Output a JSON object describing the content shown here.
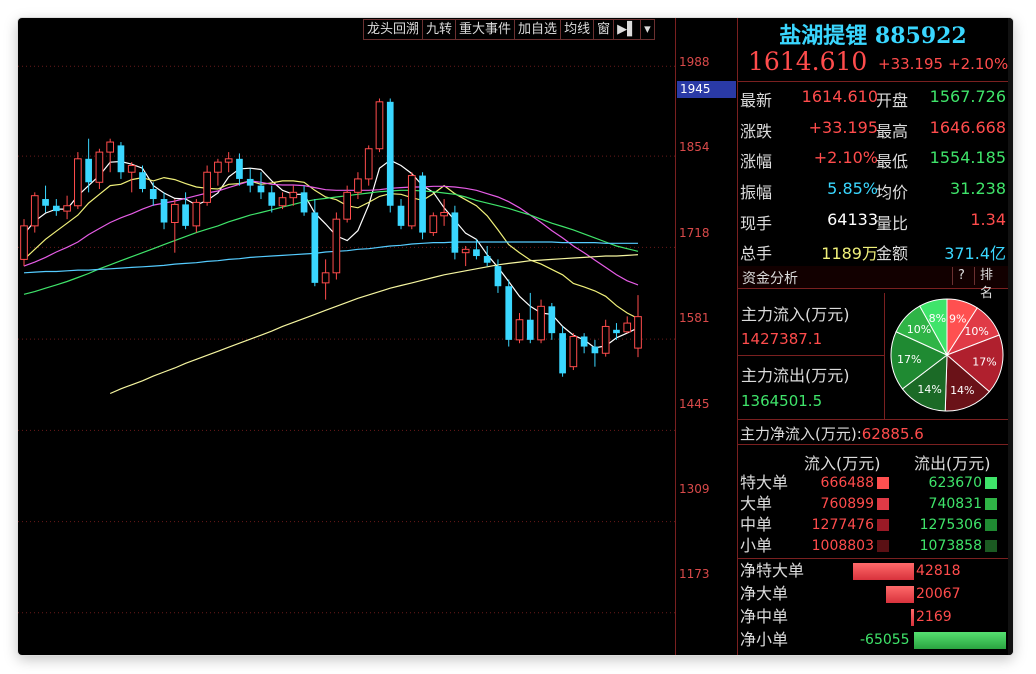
{
  "toolbar": {
    "items": [
      "龙头回溯",
      "九转",
      "重大事件",
      "加自选",
      "均线",
      "窗"
    ],
    "play_icon": "▶▌",
    "menu_icon": "▾"
  },
  "axis": {
    "ticks": [
      "1988",
      "1854",
      "1718",
      "1581",
      "1445",
      "1309",
      "1173"
    ],
    "current_marker": "1945"
  },
  "colors": {
    "up": "#ff4c4c",
    "down": "#3ad7ff",
    "ma5": "#ffffff",
    "ma10": "#f0f07a",
    "ma20": "#e65ce6",
    "ma30": "#3fe46a",
    "ma60": "#55ccff",
    "ma120": "#f5f5a0"
  },
  "quote": {
    "title": "盐湖提锂 885922",
    "price": "1614.610",
    "change": "+33.195",
    "change_pct": "+2.10%",
    "rows": [
      {
        "l1": "最新",
        "v1": "1614.610",
        "c1": "red",
        "l2": "开盘",
        "v2": "1567.726",
        "c2": "grn"
      },
      {
        "l1": "涨跌",
        "v1": "+33.195",
        "c1": "red",
        "l2": "最高",
        "v2": "1646.668",
        "c2": "red"
      },
      {
        "l1": "涨幅",
        "v1": "+2.10%",
        "c1": "red",
        "l2": "最低",
        "v2": "1554.185",
        "c2": "grn"
      },
      {
        "l1": "振幅",
        "v1": "5.85%",
        "c1": "cyan",
        "l2": "均价",
        "v2": "31.238",
        "c2": "grn"
      },
      {
        "l1": "现手",
        "v1": "64133",
        "c1": "wht",
        "l2": "量比",
        "v2": "1.34",
        "c2": "red"
      },
      {
        "l1": "总手",
        "v1": "1189万",
        "c1": "yel",
        "l2": "金额",
        "v2": "371.4亿",
        "c2": "cyan"
      }
    ]
  },
  "capital": {
    "title": "资金分析",
    "help": "?",
    "rank": "排名",
    "inflow_label": "主力流入(万元)",
    "inflow_value": "1427387.1",
    "outflow_label": "主力流出(万元)",
    "outflow_value": "1364501.5",
    "net_label": "主力净流入(万元):",
    "net_value": "62885.6",
    "pie": [
      {
        "label": "9%",
        "value": 9,
        "color": "#ff5050"
      },
      {
        "label": "10%",
        "value": 10,
        "color": "#e03a46"
      },
      {
        "label": "17%",
        "value": 17,
        "color": "#b0202e"
      },
      {
        "label": "14%",
        "value": 14,
        "color": "#6a1218"
      },
      {
        "label": "14%",
        "value": 14,
        "color": "#1b6a26"
      },
      {
        "label": "17%",
        "value": 17,
        "color": "#1f8a32"
      },
      {
        "label": "10%",
        "value": 10,
        "color": "#2fb446"
      },
      {
        "label": "8%",
        "value": 8,
        "color": "#3fe46a"
      }
    ],
    "table_head_in": "流入(万元)",
    "table_head_out": "流出(万元)",
    "table": [
      {
        "name": "特大单",
        "in": "666488",
        "out": "623670",
        "cin": "#ff5050",
        "cout": "#3fe46a"
      },
      {
        "name": "大单",
        "in": "760899",
        "out": "740831",
        "cin": "#e03a46",
        "cout": "#2fb446"
      },
      {
        "name": "中单",
        "in": "1277476",
        "out": "1275306",
        "cin": "#9a1a26",
        "cout": "#1f8a32"
      },
      {
        "name": "小单",
        "in": "1008803",
        "out": "1073858",
        "cin": "#5a1014",
        "cout": "#1b5a22"
      }
    ],
    "net": [
      {
        "name": "净特大单",
        "value": "42818",
        "amount": 42818
      },
      {
        "name": "净大单",
        "value": "20067",
        "amount": 20067
      },
      {
        "name": "净中单",
        "value": "2169",
        "amount": 2169
      },
      {
        "name": "净小单",
        "value": "-65055",
        "amount": -65055
      }
    ]
  },
  "chart_data": {
    "type": "candlestick",
    "ylim": [
      1110,
      2060
    ],
    "candles": [
      [
        1700,
        1760,
        1690,
        1750
      ],
      [
        1750,
        1800,
        1740,
        1795
      ],
      [
        1790,
        1810,
        1770,
        1780
      ],
      [
        1780,
        1790,
        1765,
        1772
      ],
      [
        1772,
        1795,
        1760,
        1780
      ],
      [
        1780,
        1860,
        1775,
        1850
      ],
      [
        1850,
        1880,
        1800,
        1815
      ],
      [
        1815,
        1865,
        1805,
        1860
      ],
      [
        1860,
        1880,
        1830,
        1875
      ],
      [
        1870,
        1875,
        1820,
        1830
      ],
      [
        1830,
        1845,
        1800,
        1840
      ],
      [
        1830,
        1840,
        1800,
        1805
      ],
      [
        1805,
        1815,
        1780,
        1790
      ],
      [
        1790,
        1800,
        1745,
        1755
      ],
      [
        1755,
        1790,
        1710,
        1782
      ],
      [
        1782,
        1800,
        1745,
        1750
      ],
      [
        1750,
        1790,
        1740,
        1785
      ],
      [
        1785,
        1840,
        1780,
        1830
      ],
      [
        1830,
        1850,
        1810,
        1845
      ],
      [
        1845,
        1860,
        1830,
        1850
      ],
      [
        1850,
        1858,
        1810,
        1820
      ],
      [
        1820,
        1835,
        1800,
        1810
      ],
      [
        1810,
        1830,
        1790,
        1800
      ],
      [
        1800,
        1810,
        1770,
        1780
      ],
      [
        1780,
        1800,
        1775,
        1792
      ],
      [
        1792,
        1810,
        1780,
        1800
      ],
      [
        1800,
        1810,
        1765,
        1770
      ],
      [
        1770,
        1790,
        1660,
        1665
      ],
      [
        1665,
        1700,
        1640,
        1680
      ],
      [
        1680,
        1770,
        1670,
        1760
      ],
      [
        1760,
        1810,
        1755,
        1800
      ],
      [
        1800,
        1830,
        1790,
        1820
      ],
      [
        1820,
        1870,
        1810,
        1865
      ],
      [
        1865,
        1940,
        1860,
        1935
      ],
      [
        1935,
        1940,
        1770,
        1780
      ],
      [
        1780,
        1790,
        1745,
        1750
      ],
      [
        1750,
        1830,
        1745,
        1825
      ],
      [
        1825,
        1830,
        1730,
        1740
      ],
      [
        1740,
        1770,
        1735,
        1765
      ],
      [
        1765,
        1790,
        1750,
        1770
      ],
      [
        1770,
        1780,
        1700,
        1710
      ],
      [
        1710,
        1720,
        1690,
        1715
      ],
      [
        1715,
        1730,
        1700,
        1705
      ],
      [
        1705,
        1720,
        1690,
        1695
      ],
      [
        1690,
        1700,
        1650,
        1660
      ],
      [
        1660,
        1670,
        1570,
        1580
      ],
      [
        1580,
        1620,
        1575,
        1610
      ],
      [
        1610,
        1650,
        1575,
        1580
      ],
      [
        1580,
        1640,
        1575,
        1630
      ],
      [
        1630,
        1635,
        1580,
        1590
      ],
      [
        1590,
        1600,
        1525,
        1530
      ],
      [
        1540,
        1590,
        1535,
        1585
      ],
      [
        1585,
        1590,
        1560,
        1570
      ],
      [
        1570,
        1580,
        1540,
        1560
      ],
      [
        1560,
        1610,
        1555,
        1600
      ],
      [
        1595,
        1605,
        1580,
        1590
      ],
      [
        1592,
        1615,
        1590,
        1605
      ],
      [
        1567.7,
        1646.7,
        1554.2,
        1614.6
      ]
    ],
    "ma_lines": [
      {
        "name": "MA5",
        "color": "#ffffff",
        "values": [
          1738,
          1757,
          1769,
          1775,
          1775,
          1795,
          1810,
          1825,
          1845,
          1846,
          1842,
          1836,
          1810,
          1799,
          1791,
          1790,
          1781,
          1788,
          1799,
          1823,
          1835,
          1836,
          1834,
          1817,
          1803,
          1797,
          1797,
          1769,
          1753,
          1735,
          1728,
          1743,
          1781,
          1836,
          1848,
          1840,
          1828,
          1810,
          1800,
          1777,
          1758,
          1739,
          1730,
          1707,
          1688,
          1667,
          1645,
          1630,
          1620,
          1618,
          1600,
          1587,
          1580,
          1568,
          1571,
          1583,
          1590,
          1598
        ]
      },
      {
        "name": "MA10",
        "color": "#f0f07a",
        "values": [
          1700,
          1715,
          1730,
          1742,
          1754,
          1766,
          1784,
          1797,
          1810,
          1812,
          1819,
          1822,
          1817,
          1822,
          1819,
          1813,
          1808,
          1806,
          1805,
          1812,
          1813,
          1817,
          1812,
          1814,
          1817,
          1817,
          1815,
          1803,
          1793,
          1789,
          1780,
          1777,
          1785,
          1794,
          1798,
          1797,
          1792,
          1788,
          1798,
          1810,
          1798,
          1789,
          1780,
          1765,
          1744,
          1722,
          1710,
          1699,
          1693,
          1685,
          1677,
          1664,
          1659,
          1653,
          1645,
          1631,
          1620,
          1612
        ]
      },
      {
        "name": "MA20",
        "color": "#e65ce6",
        "values": [
          1690,
          1696,
          1703,
          1711,
          1718,
          1726,
          1737,
          1746,
          1755,
          1762,
          1768,
          1775,
          1781,
          1784,
          1787,
          1791,
          1795,
          1799,
          1802,
          1807,
          1812,
          1817,
          1815,
          1812,
          1811,
          1811,
          1810,
          1807,
          1804,
          1803,
          1803,
          1803,
          1803,
          1804,
          1806,
          1807,
          1808,
          1808,
          1809,
          1809,
          1808,
          1806,
          1803,
          1798,
          1793,
          1786,
          1777,
          1766,
          1755,
          1743,
          1732,
          1720,
          1710,
          1699,
          1688,
          1677,
          1668,
          1662
        ]
      },
      {
        "name": "MA30",
        "color": "#3fe46a",
        "values": [
          1648,
          1652,
          1657,
          1662,
          1667,
          1673,
          1679,
          1686,
          1692,
          1698,
          1704,
          1710,
          1716,
          1722,
          1728,
          1734,
          1740,
          1745,
          1750,
          1756,
          1761,
          1766,
          1770,
          1774,
          1778,
          1782,
          1786,
          1789,
          1791,
          1793,
          1795,
          1797,
          1799,
          1801,
          1802,
          1803,
          1803,
          1802,
          1801,
          1799,
          1797,
          1793,
          1788,
          1784,
          1780,
          1776,
          1771,
          1766,
          1760,
          1754,
          1749,
          1744,
          1738,
          1732,
          1726,
          1720,
          1716,
          1712
        ]
      },
      {
        "name": "MA60",
        "color": "#55ccff",
        "values": [
          1680,
          1681,
          1682,
          1682,
          1683,
          1684,
          1684,
          1685,
          1686,
          1687,
          1688,
          1689,
          1690,
          1691,
          1693,
          1694,
          1695,
          1697,
          1698,
          1700,
          1701,
          1703,
          1704,
          1705,
          1706,
          1707,
          1708,
          1709,
          1711,
          1712,
          1713,
          1715,
          1716,
          1718,
          1720,
          1721,
          1723,
          1724,
          1725,
          1725,
          1726,
          1726,
          1726,
          1726,
          1726,
          1726,
          1726,
          1726,
          1726,
          1726,
          1725,
          1725,
          1725,
          1725,
          1724,
          1724,
          1724,
          1724
        ]
      },
      {
        "name": "MA120",
        "color": "#f5f5a0",
        "values": [
          null,
          null,
          null,
          null,
          null,
          null,
          null,
          null,
          1500,
          1507,
          1513,
          1519,
          1526,
          1532,
          1538,
          1545,
          1551,
          1557,
          1563,
          1569,
          1575,
          1581,
          1587,
          1593,
          1600,
          1606,
          1612,
          1618,
          1624,
          1630,
          1636,
          1642,
          1647,
          1652,
          1657,
          1661,
          1665,
          1669,
          1673,
          1677,
          1680,
          1683,
          1686,
          1689,
          1692,
          1694,
          1696,
          1698,
          1699,
          1700,
          1701,
          1702,
          1703,
          1704,
          1705,
          1705,
          1706,
          1707
        ]
      }
    ]
  }
}
